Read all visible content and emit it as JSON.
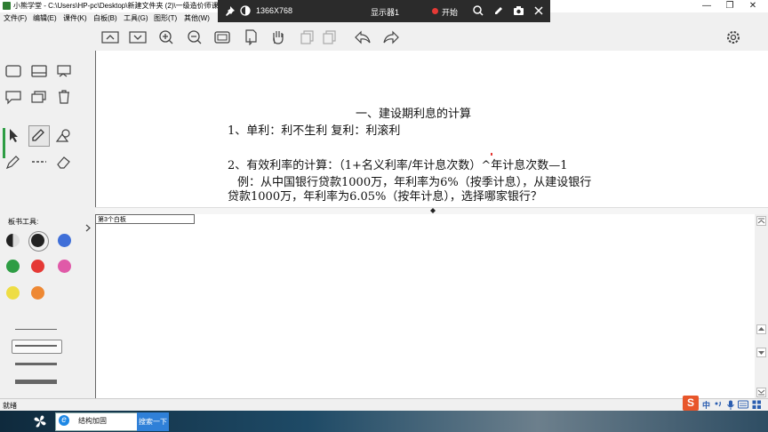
{
  "window": {
    "title": "小熊学堂 - C:\\Users\\HP-pc\\Desktop\\新建文件夹 (2)\\一级造价师课",
    "controls": [
      "—",
      "❐",
      "✕"
    ]
  },
  "menu": [
    "文件(F)",
    "编辑(E)",
    "课件(K)",
    "白板(B)",
    "工具(G)",
    "图形(T)",
    "其他(W)"
  ],
  "display_bar": {
    "resolution": "1366X768",
    "monitor": "显示器1",
    "record_label": "开始",
    "record_color": "#e53935"
  },
  "toolbar_icons": [
    "collapse-up-icon",
    "collapse-down-icon",
    "zoom-in-icon",
    "zoom-out-icon",
    "fit-screen-icon",
    "page-icon",
    "pan-hand-icon",
    "copy-icon",
    "paste-icon",
    "undo-icon",
    "redo-icon",
    "settings-icon"
  ],
  "left_panel": {
    "tools_label": "板书工具:",
    "colors": [
      "#222222",
      "#222222",
      "#3f6fd8",
      "#2e9d44",
      "#e53935",
      "#e05aa8",
      "#eedd44",
      "#ee8833"
    ]
  },
  "document": {
    "heading": "一、建设期利息的计算",
    "line1": "1、单利：利不生利  复利：利滚利",
    "line2": "2、有效利率的计算：（1+名义利率/年计息次数）^年计息次数—1",
    "line3": "例：从中国银行贷款1000万，年利率为6%（按季计息），从建设银行",
    "line4": "贷款1000万，年利率为6.05%（按年计息），选择哪家银行？"
  },
  "whiteboard": {
    "label": "第3个白板"
  },
  "status": {
    "text": "就绪"
  },
  "taskbar": {
    "search_field": "结构加固",
    "search_button": "搜索一下",
    "tray_ime": "中"
  }
}
